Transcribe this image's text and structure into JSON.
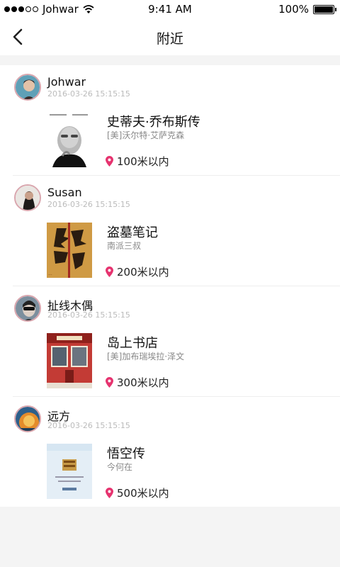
{
  "status": {
    "carrier": "Johwar",
    "time": "9:41 AM",
    "battery": "100%"
  },
  "nav": {
    "title": "附近"
  },
  "items": [
    {
      "user": "Johwar",
      "time": "2016-03-26 15:15:15",
      "book": "史蒂夫·乔布斯传",
      "author": "[美]沃尔特·艾萨克森",
      "distance": "100米以内"
    },
    {
      "user": "Susan",
      "time": "2016-03-26 15:15:15",
      "book": "盗墓笔记",
      "author": "南派三叔",
      "distance": "200米以内"
    },
    {
      "user": "扯线木偶",
      "time": "2016-03-26 15:15:15",
      "book": "岛上书店",
      "author": "[美]加布瑞埃拉·泽文",
      "distance": "300米以内"
    },
    {
      "user": "远方",
      "time": "2016-03-26 15:15:15",
      "book": "悟空传",
      "author": "今何在",
      "distance": "500米以内"
    }
  ],
  "colors": {
    "pin": "#e6336f",
    "avatar_border": "#d9a6ae"
  }
}
